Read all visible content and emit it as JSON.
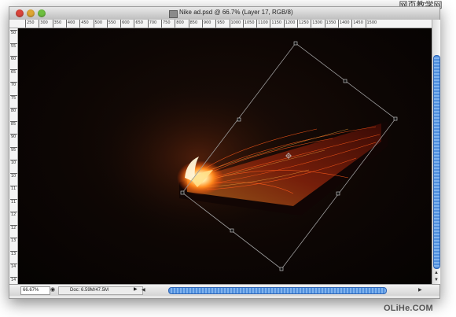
{
  "window": {
    "title": "Nike ad.psd @ 66.7% (Layer 17, RGB/8)"
  },
  "ruler": {
    "top_ticks": [
      "250",
      "300",
      "350",
      "400",
      "450",
      "500",
      "550",
      "600",
      "650",
      "700",
      "750",
      "800",
      "850",
      "900",
      "950",
      "1000",
      "1050",
      "1100",
      "1150",
      "1200",
      "1250",
      "1300",
      "1350",
      "1400",
      "1450",
      "1500"
    ],
    "left_ticks": [
      "500",
      "550",
      "600",
      "650",
      "700",
      "750",
      "800",
      "850",
      "900",
      "950",
      "1000",
      "1050",
      "1100",
      "1150",
      "1200",
      "1250",
      "1300",
      "1350",
      "1400",
      "1450"
    ]
  },
  "status": {
    "zoom": "66.67%",
    "doc_size": "Doc: 6.59M/47.5M"
  },
  "watermarks": {
    "top_cn": "网页教学网",
    "top_url": "WEBJX.COM",
    "bottom": "OLiHe.COM"
  },
  "icons": {
    "status_icon": "layer-preview-icon",
    "arrow_right": "triangle-right-icon"
  }
}
